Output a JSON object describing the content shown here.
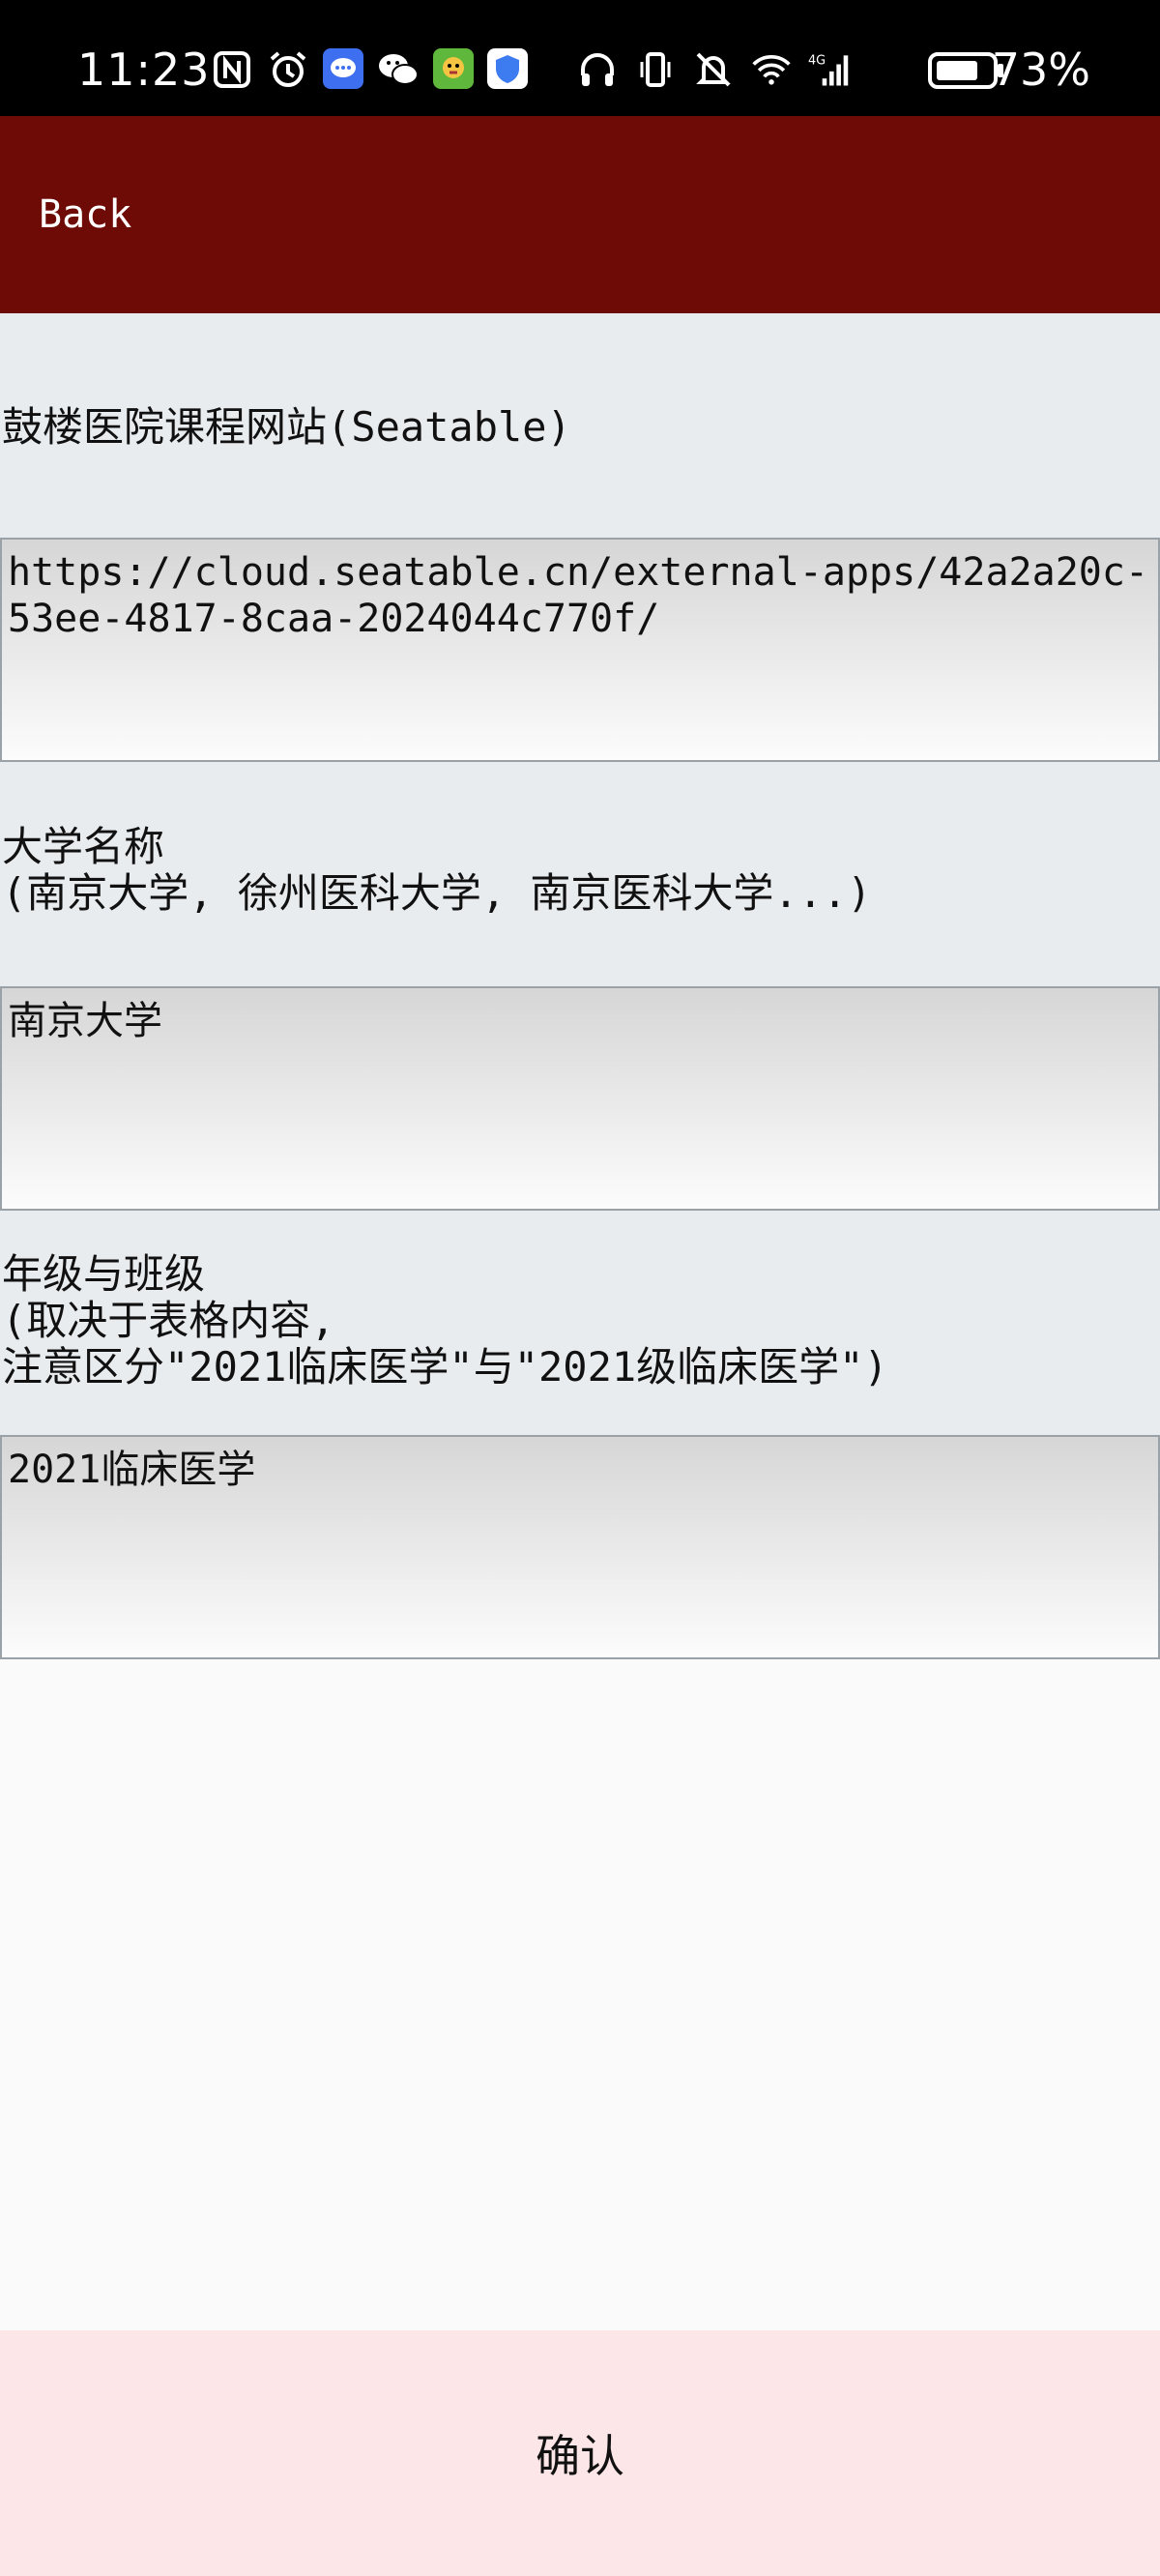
{
  "status_bar": {
    "time": "11:23",
    "battery": "73%",
    "left_icons": [
      "nfc-icon",
      "alarm-icon",
      "messages-app-icon",
      "wechat-icon",
      "game-app-icon",
      "shield-app-icon"
    ],
    "right_icons": [
      "headphones-icon",
      "vibrate-icon",
      "mute-icon",
      "wifi-icon",
      "signal-icon",
      "battery-icon"
    ],
    "network": "4G"
  },
  "header": {
    "back_label": "Back",
    "color": "#6e0b07"
  },
  "form": {
    "field1": {
      "label": "鼓楼医院课程网站(Seatable)",
      "value": "https://cloud.seatable.cn/external-apps/42a2a20c-53ee-4817-8caa-2024044c770f/"
    },
    "field2": {
      "label": "大学名称\n(南京大学, 徐州医科大学, 南京医科大学...)",
      "value": "南京大学"
    },
    "field3": {
      "label": "年级与班级\n(取决于表格内容,\n注意区分\"2021临床医学\"与\"2021级临床医学\")",
      "value": "2021临床医学"
    }
  },
  "confirm": {
    "label": "确认",
    "color": "#fde6e8"
  }
}
